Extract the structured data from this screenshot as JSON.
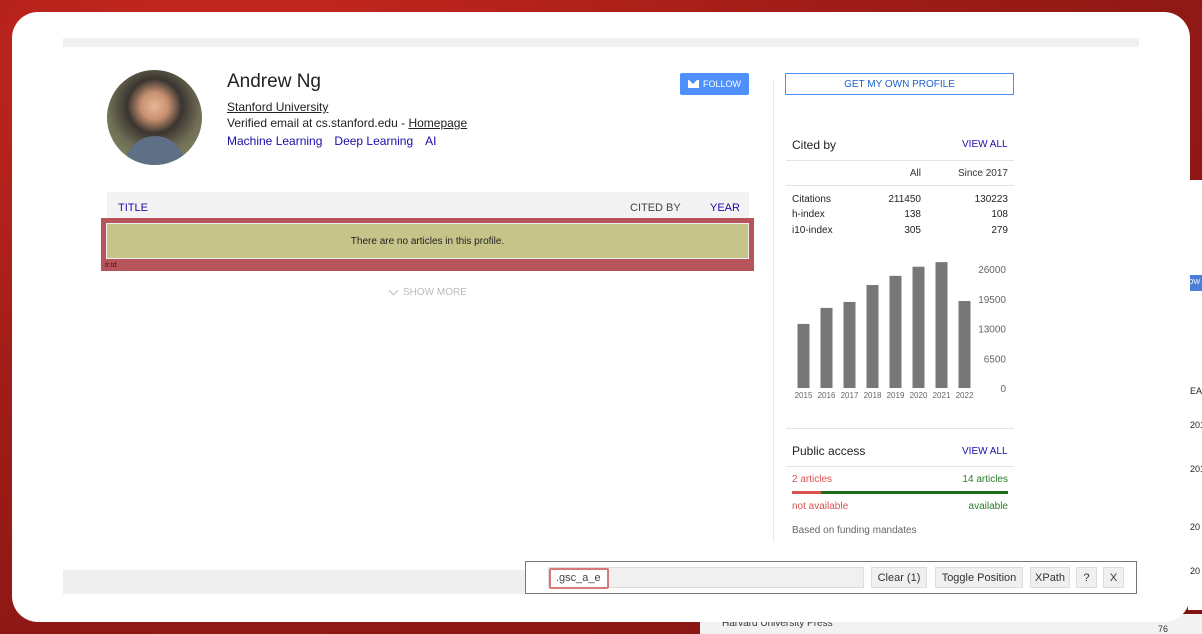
{
  "profile": {
    "name": "Andrew Ng",
    "affiliation": "Stanford University",
    "email_prefix": "Verified email at cs.stanford.edu - ",
    "homepage_link": "Homepage",
    "interests": [
      "Machine Learning",
      "Deep Learning",
      "AI"
    ],
    "follow_label": "FOLLOW",
    "get_profile_label": "GET MY OWN PROFILE"
  },
  "articles": {
    "col_title": "TITLE",
    "col_cited": "CITED BY",
    "col_year": "YEAR",
    "empty_message": "There are no articles in this profile.",
    "highlight_tag": "tr.td",
    "show_more": "SHOW MORE"
  },
  "cited_by": {
    "title": "Cited by",
    "view_all": "VIEW ALL",
    "col_all": "All",
    "col_since": "Since 2017",
    "rows": [
      {
        "label": "Citations",
        "all": "211450",
        "since": "130223"
      },
      {
        "label": "h-index",
        "all": "138",
        "since": "108"
      },
      {
        "label": "i10-index",
        "all": "305",
        "since": "279"
      }
    ]
  },
  "chart_data": {
    "type": "bar",
    "categories": [
      "2015",
      "2016",
      "2017",
      "2018",
      "2019",
      "2020",
      "2021",
      "2022"
    ],
    "values": [
      14000,
      17500,
      18800,
      22500,
      24500,
      26500,
      27500,
      19000
    ],
    "ylim": [
      0,
      26000
    ],
    "yticks": [
      "26000",
      "19500",
      "13000",
      "6500",
      "0"
    ],
    "bar_color": "#777777"
  },
  "public_access": {
    "title": "Public access",
    "view_all": "VIEW ALL",
    "left_count": "2 articles",
    "right_count": "14 articles",
    "left_status": "not available",
    "right_status": "available",
    "note": "Based on funding mandates",
    "colors": {
      "unavailable": "#d9534f",
      "available": "#1d6b1d"
    }
  },
  "selector_toolbar": {
    "selector_value": ".gsc_a_e",
    "clear_label": "Clear (1)",
    "toggle_label": "Toggle Position",
    "xpath_label": "XPath",
    "help_label": "?",
    "close_label": "X"
  },
  "background": {
    "press_text": "Harvard University Press",
    "corner_num": "76",
    "edge_snippets": [
      "OW",
      "EA",
      "201",
      "201",
      "20",
      "20"
    ]
  }
}
